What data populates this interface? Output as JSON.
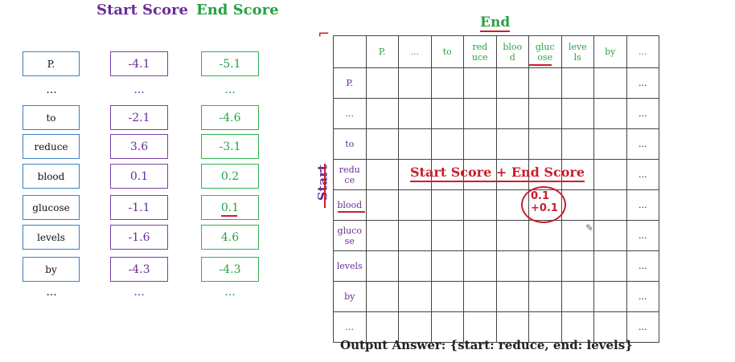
{
  "headers": {
    "start_score": "Start Score",
    "end_score": "End Score"
  },
  "rows": [
    {
      "token": "P.",
      "start": "-4.1",
      "end": "-5.1"
    },
    {
      "token": "...",
      "start": "...",
      "end": "..."
    },
    {
      "token": "to",
      "start": "-2.1",
      "end": "-4.6"
    },
    {
      "token": "reduce",
      "start": "3.6",
      "end": "-3.1"
    },
    {
      "token": "blood",
      "start": "0.1",
      "end": "0.2"
    },
    {
      "token": "glucose",
      "start": "-1.1",
      "end": "0.1"
    },
    {
      "token": "levels",
      "start": "-1.6",
      "end": "4.6"
    },
    {
      "token": "by",
      "start": "-4.3",
      "end": "-4.3"
    },
    {
      "token": "...",
      "start": "...",
      "end": "..."
    }
  ],
  "matrix": {
    "axis_end": "End",
    "axis_start": "Start",
    "col_headers": [
      "P.",
      "...",
      "to",
      "red uce",
      "bloo d",
      "gluc ose",
      "leve ls",
      "by",
      "..."
    ],
    "row_headers": [
      "P.",
      "...",
      "to",
      "redu ce",
      "blood",
      "gluco se",
      "levels",
      "by",
      "..."
    ],
    "annotation": "Start Score + End Score",
    "sum_line1": "0.1",
    "sum_line2": "+0.1"
  },
  "footer": "Output Answer:  {start: reduce, end: levels}",
  "colors": {
    "start": "#6a2c95",
    "end": "#26a243",
    "token_border": "#3d7fc4",
    "annotation": "#c8202c"
  }
}
